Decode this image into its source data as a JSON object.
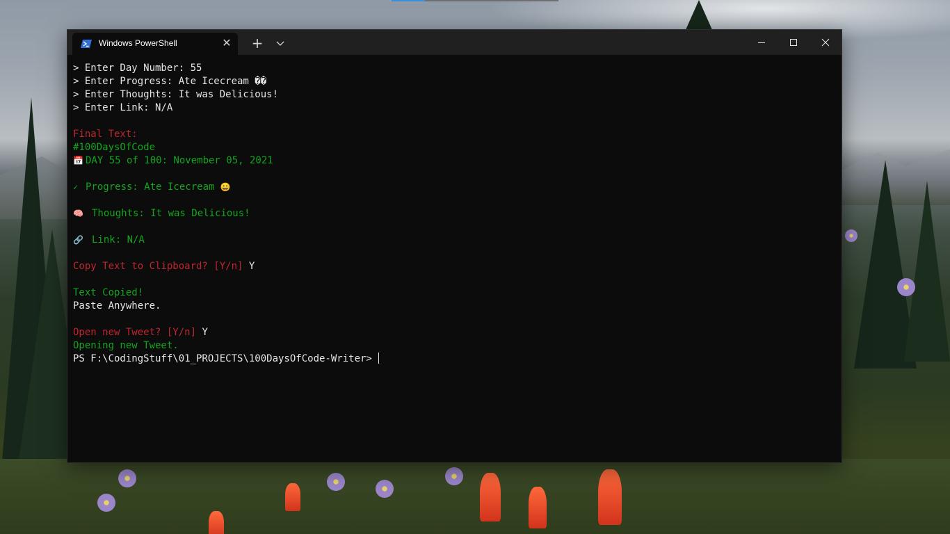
{
  "window": {
    "tab_title": "Windows PowerShell",
    "tab_icon": "powershell-icon",
    "new_tab_label": "+",
    "colors": {
      "titlebar": "#202020",
      "terminal_bg": "#0c0c0c",
      "text_white": "#e6e6e6",
      "text_red": "#c0262e",
      "text_green": "#13a51e"
    }
  },
  "terminal": {
    "lines": [
      {
        "prompt": "> ",
        "text": "Enter Day Number: 55"
      },
      {
        "prompt": "> ",
        "text": "Enter Progress: Ate Icecream ��"
      },
      {
        "prompt": "> ",
        "text": "Enter Thoughts: It was Delicious!"
      },
      {
        "prompt": "> ",
        "text": "Enter Link: N/A"
      }
    ],
    "final_text_label": "Final Text:",
    "hashtag": "#100DaysOfCode",
    "calendar_icon": "📅",
    "day_line": "DAY 55 of 100: November 05, 2021",
    "check_icon": "✓",
    "progress_line": "Progress: Ate Icecream",
    "progress_emoji": "😀",
    "brain_icon": "🧠",
    "thoughts_line": "Thoughts: It was Delicious!",
    "link_icon": "🔗",
    "link_line": "Link: N/A",
    "copy_question": "Copy Text to Clipboard? [Y/n]",
    "copy_answer": "Y",
    "copied_msg": "Text Copied!",
    "paste_msg": "Paste Anywhere.",
    "tweet_question": "Open new Tweet? [Y/n]",
    "tweet_answer": "Y",
    "opening_msg": "Opening new Tweet.",
    "ps_prompt": "PS F:\\CodingStuff\\01_PROJECTS\\100DaysOfCode-Writer>"
  }
}
